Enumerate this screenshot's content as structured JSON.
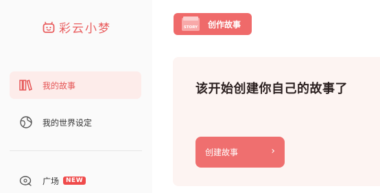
{
  "app": {
    "name": "彩云小梦"
  },
  "sidebar": {
    "items": [
      {
        "label": "我的故事",
        "icon": "bookshelf-icon",
        "active": true
      },
      {
        "label": "我的世界设定",
        "icon": "globe-icon",
        "active": false
      },
      {
        "label": "广场",
        "icon": "plaza-icon",
        "badge": "NEW"
      }
    ]
  },
  "header": {
    "tag_label": "创作故事",
    "tag_icon_text": "STORY"
  },
  "main": {
    "title": "该开始创建你自己的故事了",
    "button_label": "创建故事",
    "button_arrow": "›"
  },
  "colors": {
    "accent": "#ef6a6a",
    "active_bg": "#fdecea",
    "card_bg": "#fdf4f2"
  }
}
